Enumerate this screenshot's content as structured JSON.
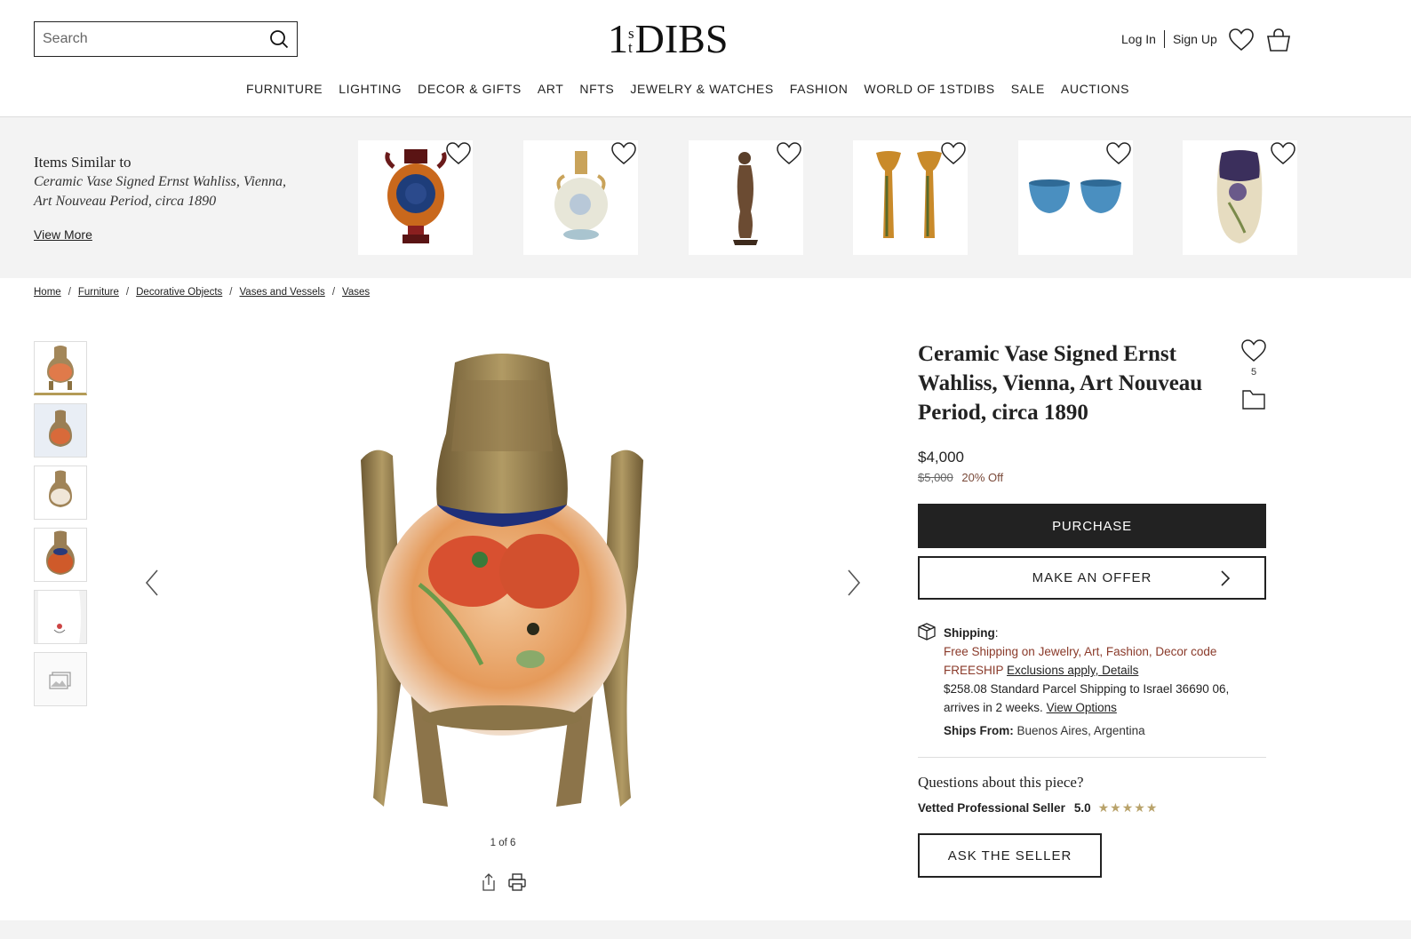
{
  "header": {
    "search_placeholder": "Search",
    "logo": "1stDIBS",
    "logo_one": "1",
    "logo_s": "s",
    "logo_t": "t",
    "logo_dibs": "DIBS",
    "login": "Log In",
    "signup": "Sign Up",
    "nav": [
      "FURNITURE",
      "LIGHTING",
      "DECOR & GIFTS",
      "ART",
      "NFTS",
      "JEWELRY & WATCHES",
      "FASHION",
      "WORLD OF 1STDIBS",
      "SALE",
      "AUCTIONS"
    ]
  },
  "similar": {
    "title": "Items Similar to",
    "subtitle": "Ceramic Vase Signed Ernst Wahliss, Vienna, Art Nouveau Period, circa 1890",
    "view_more": "View More",
    "items": [
      "urn-vase",
      "ewer-vase",
      "bronze-figure",
      "pair-vases",
      "blue-bowls",
      "floral-vase"
    ]
  },
  "breadcrumb": [
    "Home",
    "Furniture",
    "Decorative Objects",
    "Vases and Vessels",
    "Vases"
  ],
  "gallery": {
    "counter": "1 of 6",
    "thumb_count": 6
  },
  "product": {
    "title": "Ceramic Vase Signed Ernst Wahliss, Vienna, Art Nouveau Period, circa 1890",
    "favorites": "5",
    "price": "$4,000",
    "original_price": "$5,000",
    "discount": "20% Off",
    "purchase_label": "PURCHASE",
    "offer_label": "MAKE AN OFFER",
    "shipping_label": "Shipping",
    "shipping_promo": "Free Shipping on Jewelry, Art, Fashion, Decor code FREESHIP",
    "shipping_promo_link": "Exclusions apply, Details",
    "shipping_cost": "$258.08 Standard Parcel Shipping to Israel 36690 06, arrives in 2 weeks.",
    "shipping_options_link": "View Options",
    "ships_from_label": "Ships From:",
    "ships_from": "Buenos Aires, Argentina",
    "questions": "Questions about this piece?",
    "seller_label": "Vetted Professional Seller",
    "seller_rating": "5.0",
    "stars": "★★★★★",
    "ask_label": "ASK THE SELLER"
  },
  "colors": {
    "dark": "#222222",
    "accent_gold": "#b49b57",
    "promo_red": "#8a3a2a",
    "strip_bg": "#f3f3f3"
  }
}
